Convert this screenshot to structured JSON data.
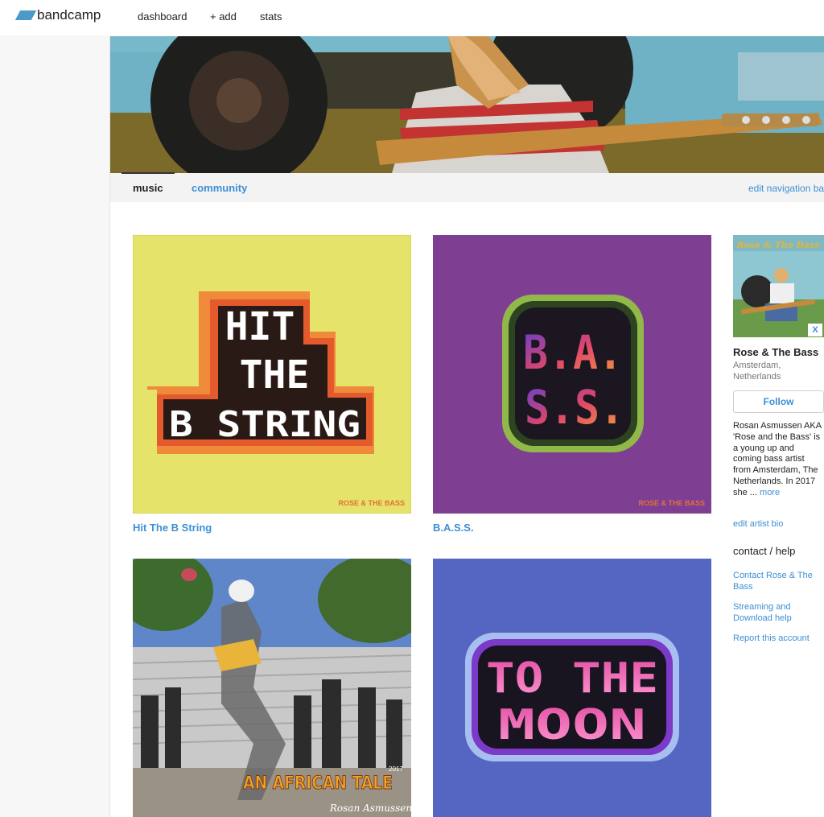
{
  "logo": {
    "text": "bandcamp"
  },
  "topnav": [
    {
      "label": "dashboard"
    },
    {
      "label": "+ add"
    },
    {
      "label": "stats"
    }
  ],
  "bandnav": {
    "tabs": [
      {
        "label": "music",
        "active": true
      },
      {
        "label": "community",
        "active": false
      }
    ],
    "edit_label": "edit navigation bar"
  },
  "albums": [
    {
      "title": "Hit The B String",
      "art_text": [
        "HIT",
        "THE",
        "B STRING"
      ],
      "label_text": "ROSE & THE BASS",
      "bg": "#e6e36a"
    },
    {
      "title": "B.A.S.S.",
      "art_text": [
        "B.A.",
        "S.S."
      ],
      "label_text": "ROSE & THE BASS",
      "bg": "#7e3f93"
    },
    {
      "title": "",
      "art_text": [
        "AN AFRICAN TALE"
      ],
      "year": "2017",
      "signature": "Rosan Asmussen"
    },
    {
      "title": "",
      "art_text": [
        "TO THE",
        "MOON"
      ],
      "bg": "#5465c2"
    }
  ],
  "sidebar": {
    "photo_caption": "Rose & The Bass",
    "close_label": "X",
    "artist_name": "Rose & The Bass",
    "location": "Amsterdam, Netherlands",
    "follow_label": "Follow",
    "bio": "Rosan Asmussen AKA 'Rose and the Bass' is a young up and coming bass artist from Amsterdam, The Netherlands. In 2017 she ...",
    "more_label": "more",
    "edit_bio_label": "edit artist bio",
    "contact_heading": "contact / help",
    "links": [
      {
        "label": "Contact Rose & The Bass"
      },
      {
        "label": "Streaming and Download help"
      },
      {
        "label": "Report this account"
      }
    ]
  },
  "colors": {
    "link": "#3d8fd6",
    "logo": "#4b9ac9",
    "navbar_bg": "#f3f3f3"
  }
}
